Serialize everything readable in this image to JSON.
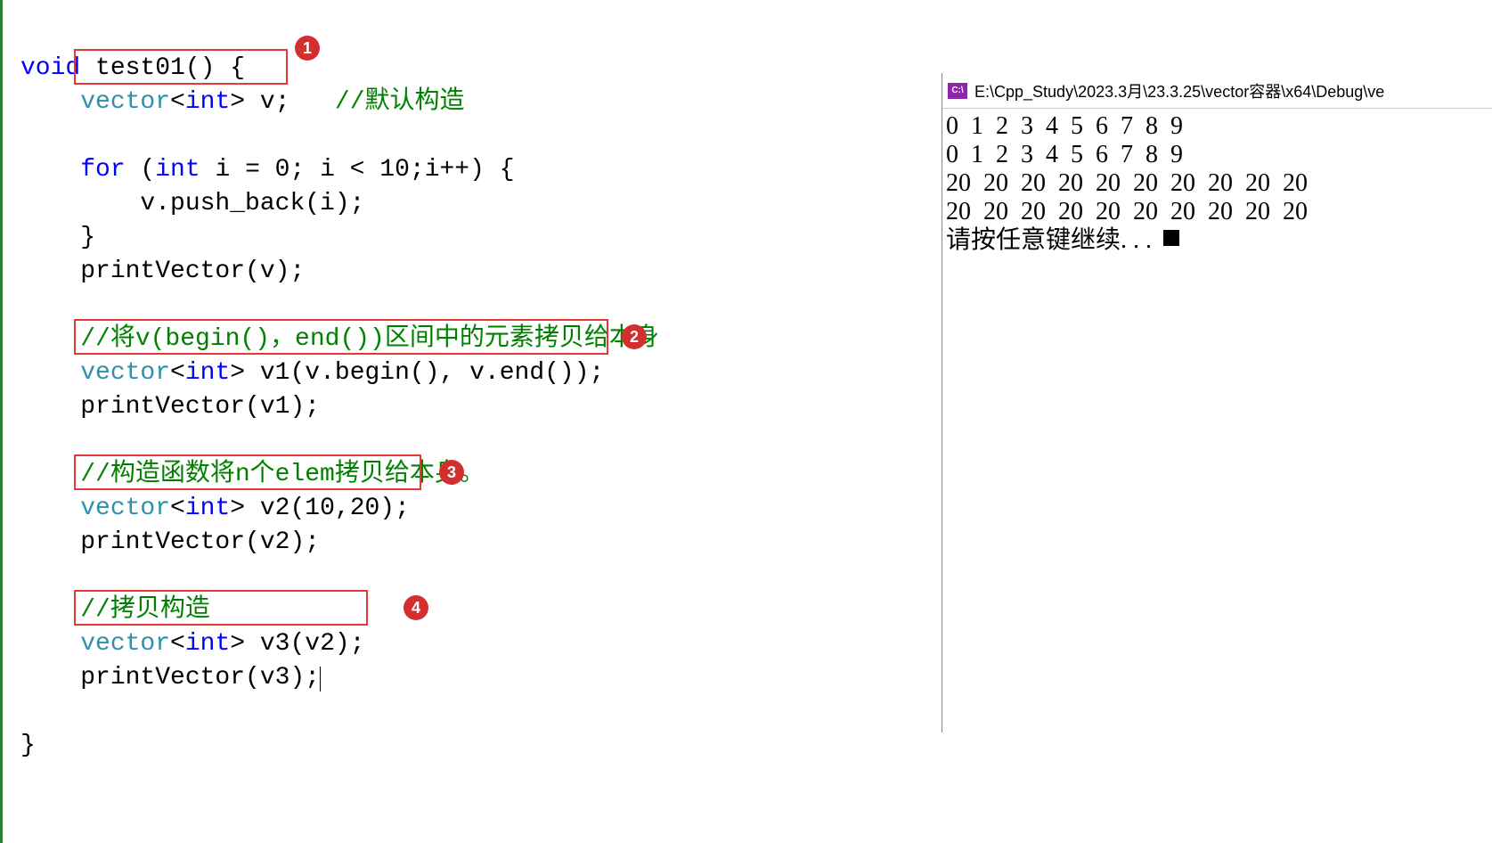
{
  "code": {
    "line1_pre": "void",
    "line1_fn": " test01() {",
    "line2_type": "vector",
    "line2_lt": "<",
    "line2_int": "int",
    "line2_rest": "> v;",
    "line2_comment": "   //默认构造",
    "line3": "",
    "line4_for": "    for",
    "line4_paren": " (",
    "line4_int": "int",
    "line4_rest": " i = 0; i < 10;i++) {",
    "line5": "        v.push_back(i);",
    "line6": "    }",
    "line7": "    printVector(v);",
    "line8": "",
    "line9_comment": "    //将v(begin()，end())区间中的元素拷贝给本身",
    "line10_type": "    vector",
    "line10_lt": "<",
    "line10_int": "int",
    "line10_rest": "> v1(v.begin(), v.end());",
    "line11": "    printVector(v1);",
    "line12": "",
    "line13_comment": "    //构造函数将n个elem拷贝给本身。",
    "line14_type": "    vector",
    "line14_lt": "<",
    "line14_int": "int",
    "line14_rest": "> v2(10,20);",
    "line15": "    printVector(v2);",
    "line16": "",
    "line17_comment": "    //拷贝构造",
    "line18_type": "    vector",
    "line18_lt": "<",
    "line18_int": "int",
    "line18_rest": "> v3(v2);",
    "line19": "    printVector(v3);",
    "line20": "",
    "line21": "}"
  },
  "badges": {
    "b1": "1",
    "b2": "2",
    "b3": "3",
    "b4": "4"
  },
  "console": {
    "icon_text": "C:\\",
    "title": " E:\\Cpp_Study\\2023.3月\\23.3.25\\vector容器\\x64\\Debug\\ve",
    "out1": "0  1  2  3  4  5  6  7  8  9",
    "out2": "0  1  2  3  4  5  6  7  8  9",
    "out3": "20  20  20  20  20  20  20  20  20  20",
    "out4": "20  20  20  20  20  20  20  20  20  20",
    "prompt": "请按任意键继续. . . "
  },
  "fold_glyph": "-"
}
